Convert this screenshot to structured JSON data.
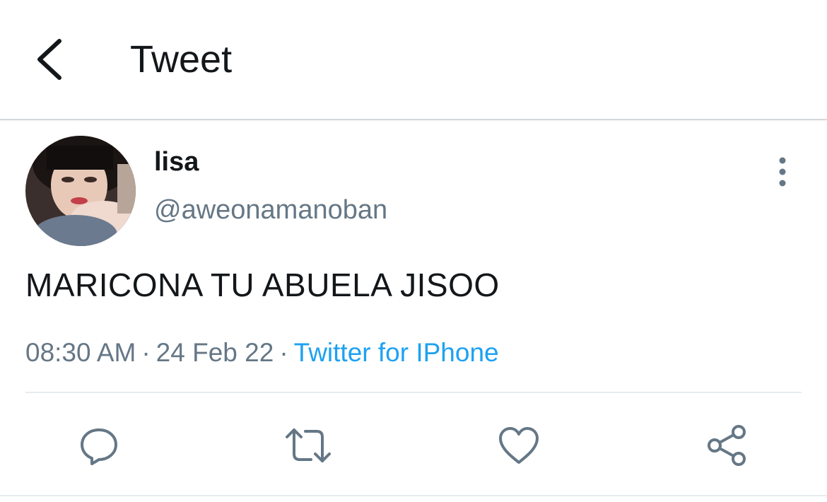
{
  "header": {
    "title": "Tweet",
    "back_icon": "chevron-left-icon"
  },
  "tweet": {
    "display_name": "lisa",
    "handle": "@aweonamanoban",
    "text": "MARICONA TU ABUELA JISOO",
    "time": "08:30 AM",
    "date": "24 Feb 22",
    "source": "Twitter for IPhone",
    "separator": "·"
  },
  "actions": {
    "reply_icon": "reply-icon",
    "retweet_icon": "retweet-icon",
    "like_icon": "heart-icon",
    "share_icon": "share-icon"
  },
  "colors": {
    "text_primary": "#14171a",
    "text_secondary": "#657786",
    "link": "#1da1f2",
    "divider": "#e6ecf0"
  }
}
